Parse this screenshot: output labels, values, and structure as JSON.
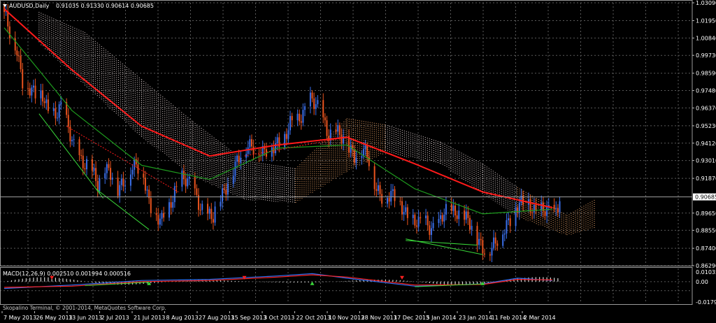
{
  "header": {
    "symbol": "AUDUSD,Daily",
    "ohlc": "0.91035 0.91330 0.90614 0.90685"
  },
  "macd_header": "MACD(12,26,9) 0.002510 0.001994 0.000516",
  "footer": "Skopalino Terminal, © 2001-2014, MetaQuotes Software Corp.",
  "colors": {
    "background": "#000000",
    "grid": "#5a5a5a",
    "bull": "#3a6ee8",
    "bear": "#e8531e",
    "ma_red": "#ff1a1a",
    "ma_green": "#1e9b1e",
    "cloud_a": "#e6d6d6",
    "cloud_b": "#f2a86a",
    "macd_main": "#2f6ff0",
    "macd_signal": "#ff2020",
    "histogram": "#d8d8d8",
    "divergence": "#39d839",
    "price_line": "#a0a0a0",
    "price_label_bg": "#ffffff",
    "price_label_text": "#000000"
  },
  "chart_data": [
    {
      "type": "candlestick",
      "symbol": "AUDUSD",
      "timeframe": "Daily",
      "last_price": "0.90685",
      "ylim": [
        0.8629,
        1.0309
      ],
      "y_ticks": [
        "1.03090",
        "1.01950",
        "1.00840",
        "0.99730",
        "0.98590",
        "0.97480",
        "0.96370",
        "0.95230",
        "0.94120",
        "0.93010",
        "0.91870",
        "0.90685",
        "0.89650",
        "0.88550",
        "0.87400",
        "0.86290"
      ],
      "x_ticks": [
        "7 May 2013",
        "26 May 2013",
        "13 Jun 2013",
        "2 Jul 2013",
        "21 Jul 2013",
        "8 Aug 2013",
        "27 Aug 2013",
        "15 Sep 2013",
        "3 Oct 2013",
        "22 Oct 2013",
        "10 Nov 2013",
        "28 Nov 2013",
        "17 Dec 2013",
        "5 Jan 2014",
        "23 Jan 2014",
        "11 Feb 2014",
        "2 Mar 2014"
      ],
      "close_path": [
        [
          "2013-05-07",
          1.025
        ],
        [
          "2013-05-10",
          1.01
        ],
        [
          "2013-05-14",
          1.0
        ],
        [
          "2013-05-17",
          0.983
        ],
        [
          "2013-05-21",
          0.976
        ],
        [
          "2013-05-24",
          0.97
        ],
        [
          "2013-05-28",
          0.972
        ],
        [
          "2013-05-31",
          0.964
        ],
        [
          "2013-06-04",
          0.959
        ],
        [
          "2013-06-07",
          0.962
        ],
        [
          "2013-06-10",
          0.954
        ],
        [
          "2013-06-13",
          0.945
        ],
        [
          "2013-06-17",
          0.932
        ],
        [
          "2013-06-20",
          0.925
        ],
        [
          "2013-06-24",
          0.923
        ],
        [
          "2013-06-27",
          0.917
        ],
        [
          "2013-07-01",
          0.926
        ],
        [
          "2013-07-04",
          0.92
        ],
        [
          "2013-07-08",
          0.911
        ],
        [
          "2013-07-11",
          0.918
        ],
        [
          "2013-07-15",
          0.926
        ],
        [
          "2013-07-18",
          0.925
        ],
        [
          "2013-07-22",
          0.92
        ],
        [
          "2013-07-25",
          0.905
        ],
        [
          "2013-07-29",
          0.895
        ],
        [
          "2013-08-01",
          0.89
        ],
        [
          "2013-08-05",
          0.899
        ],
        [
          "2013-08-08",
          0.912
        ],
        [
          "2013-08-12",
          0.92
        ],
        [
          "2013-08-15",
          0.915
        ],
        [
          "2013-08-19",
          0.908
        ],
        [
          "2013-08-22",
          0.902
        ],
        [
          "2013-08-26",
          0.896
        ],
        [
          "2013-08-29",
          0.892
        ],
        [
          "2013-09-02",
          0.905
        ],
        [
          "2013-09-05",
          0.915
        ],
        [
          "2013-09-09",
          0.925
        ],
        [
          "2013-09-12",
          0.93
        ],
        [
          "2013-09-16",
          0.938
        ],
        [
          "2013-09-19",
          0.942
        ],
        [
          "2013-09-23",
          0.937
        ],
        [
          "2013-09-26",
          0.933
        ],
        [
          "2013-09-30",
          0.938
        ],
        [
          "2013-10-03",
          0.943
        ],
        [
          "2013-10-07",
          0.945
        ],
        [
          "2013-10-10",
          0.952
        ],
        [
          "2013-10-14",
          0.955
        ],
        [
          "2013-10-17",
          0.962
        ],
        [
          "2013-10-21",
          0.97
        ],
        [
          "2013-10-24",
          0.964
        ],
        [
          "2013-10-28",
          0.955
        ],
        [
          "2013-10-31",
          0.948
        ],
        [
          "2013-11-04",
          0.95
        ],
        [
          "2013-11-07",
          0.943
        ],
        [
          "2013-11-11",
          0.938
        ],
        [
          "2013-11-14",
          0.935
        ],
        [
          "2013-11-18",
          0.938
        ],
        [
          "2013-11-21",
          0.932
        ],
        [
          "2013-11-25",
          0.915
        ],
        [
          "2013-11-28",
          0.91
        ],
        [
          "2013-12-02",
          0.908
        ],
        [
          "2013-12-05",
          0.906
        ],
        [
          "2013-12-09",
          0.902
        ],
        [
          "2013-12-12",
          0.898
        ],
        [
          "2013-12-16",
          0.892
        ],
        [
          "2013-12-19",
          0.888
        ],
        [
          "2013-12-23",
          0.89
        ],
        [
          "2013-12-26",
          0.888
        ],
        [
          "2013-12-30",
          0.89
        ],
        [
          "2014-01-02",
          0.895
        ],
        [
          "2014-01-06",
          0.897
        ],
        [
          "2014-01-09",
          0.899
        ],
        [
          "2014-01-13",
          0.895
        ],
        [
          "2014-01-16",
          0.888
        ],
        [
          "2014-01-20",
          0.88
        ],
        [
          "2014-01-23",
          0.876
        ],
        [
          "2014-01-27",
          0.874
        ],
        [
          "2014-01-30",
          0.875
        ],
        [
          "2014-02-03",
          0.885
        ],
        [
          "2014-02-06",
          0.893
        ],
        [
          "2014-02-10",
          0.9
        ],
        [
          "2014-02-13",
          0.901
        ],
        [
          "2014-02-17",
          0.902
        ],
        [
          "2014-02-20",
          0.9
        ],
        [
          "2014-02-24",
          0.899
        ],
        [
          "2014-02-27",
          0.896
        ],
        [
          "2014-03-03",
          0.895
        ],
        [
          "2014-03-06",
          0.907
        ]
      ],
      "series": [
        {
          "name": "",
          "line": "moving-average-red",
          "values": [
            [
              "2013-05-07",
              1.027
            ],
            [
              "2013-06-13",
              0.988
            ],
            [
              "2013-07-21",
              0.952
            ],
            [
              "2013-08-27",
              0.933
            ],
            [
              "2013-10-03",
              0.94
            ],
            [
              "2013-11-10",
              0.945
            ],
            [
              "2013-12-17",
              0.928
            ],
            [
              "2014-01-23",
              0.91
            ],
            [
              "2014-03-02",
              0.9
            ]
          ]
        },
        {
          "name": "",
          "line": "moving-average-green",
          "values": [
            [
              "2013-05-07",
              1.015
            ],
            [
              "2013-06-13",
              0.962
            ],
            [
              "2013-07-21",
              0.927
            ],
            [
              "2013-08-27",
              0.918
            ],
            [
              "2013-10-03",
              0.938
            ],
            [
              "2013-11-10",
              0.94
            ],
            [
              "2013-12-17",
              0.912
            ],
            [
              "2014-01-23",
              0.896
            ],
            [
              "2014-03-02",
              0.899
            ]
          ]
        },
        {
          "name": "",
          "line": "ichimoku-cloud",
          "values": [
            [
              "2013-05-26",
              1.025,
              1.005
            ],
            [
              "2013-06-20",
              1.012,
              0.978
            ],
            [
              "2013-07-21",
              0.982,
              0.945
            ],
            [
              "2013-08-18",
              0.955,
              0.92
            ],
            [
              "2013-09-15",
              0.93,
              0.905
            ],
            [
              "2013-10-13",
              0.925,
              0.903
            ],
            [
              "2013-11-10",
              0.957,
              0.923
            ],
            [
              "2013-12-01",
              0.953,
              0.935
            ],
            [
              "2013-12-31",
              0.942,
              0.928
            ],
            [
              "2014-01-23",
              0.928,
              0.909
            ],
            [
              "2014-02-11",
              0.913,
              0.894
            ],
            [
              "2014-03-10",
              0.895,
              0.882
            ],
            [
              "2014-03-25",
              0.905,
              0.887
            ]
          ]
        }
      ]
    },
    {
      "type": "area",
      "indicator": "MACD(12,26,9)",
      "values_text": [
        "0.002510",
        "0.001994",
        "0.000516"
      ],
      "ylim": [
        -0.01795,
        0.01035
      ],
      "y_ticks": [
        "0.01035",
        "0.00",
        "-0.01795"
      ],
      "series": [
        {
          "name": "",
          "line": "macd-main",
          "values": [
            [
              "2013-05-07",
              -0.006
            ],
            [
              "2013-06-13",
              -0.003
            ],
            [
              "2013-07-21",
              0.001
            ],
            [
              "2013-08-27",
              0.002
            ],
            [
              "2013-10-03",
              0.005
            ],
            [
              "2013-10-22",
              0.007
            ],
            [
              "2013-11-10",
              0.003
            ],
            [
              "2013-12-17",
              -0.004
            ],
            [
              "2014-01-23",
              -0.002
            ],
            [
              "2014-02-11",
              0.003
            ],
            [
              "2014-03-02",
              0.001
            ]
          ]
        },
        {
          "name": "",
          "line": "macd-signal",
          "values": [
            [
              "2013-05-07",
              -0.005
            ],
            [
              "2013-06-13",
              -0.004
            ],
            [
              "2013-07-21",
              0.0
            ],
            [
              "2013-08-27",
              0.001
            ],
            [
              "2013-10-03",
              0.004
            ],
            [
              "2013-10-22",
              0.006
            ],
            [
              "2013-11-10",
              0.004
            ],
            [
              "2013-12-17",
              -0.003
            ],
            [
              "2014-01-23",
              -0.0025
            ],
            [
              "2014-02-11",
              0.002
            ],
            [
              "2014-03-02",
              0.0015
            ]
          ]
        }
      ]
    }
  ]
}
